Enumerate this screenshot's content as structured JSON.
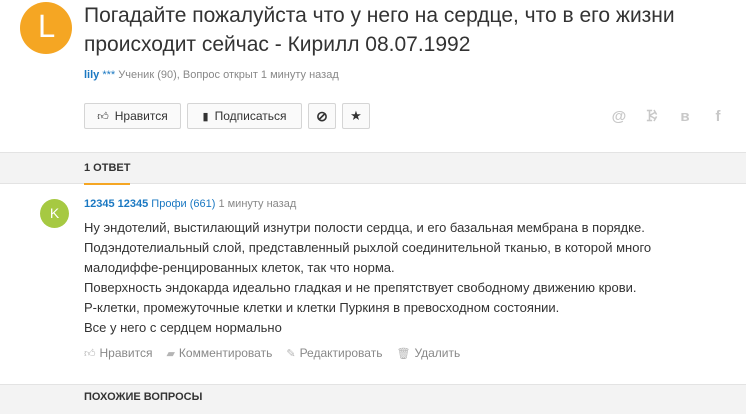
{
  "question": {
    "avatar_letter": "L",
    "title": "Погадайте пожалуйста что у него на сердце, что в его жизни происходит сейчас - Кирилл 08.07.1992",
    "author": "lily",
    "author_stars": "***",
    "meta_text": "Ученик (90), Вопрос открыт 1 минуту назад"
  },
  "actions": {
    "like_label": "Нравится",
    "subscribe_label": "Подписаться"
  },
  "share_icons": [
    "mail-ru-icon",
    "odnoklassniki-icon",
    "vkontakte-icon",
    "facebook-icon"
  ],
  "answers_tab": {
    "label": "1 ОТВЕТ"
  },
  "answer": {
    "avatar_letter": "K",
    "author": "12345 12345",
    "rank": "Профи (661)",
    "time": "1 минуту назад",
    "lines": [
      "Ну эндотелий, выстилающий изнутри полости сердца, и его базальная мембрана в порядке.",
      "Подэндотелиальный слой, представленный рыхлой соединительной тканью, в которой много",
      "малодиффе-ренцированных клеток, так что норма.",
      "Поверхность эндокарда идеально гладкая и не препятствует свободному движению крови.",
      "Р-клетки, промежуточные клетки и клетки Пуркиня в превосходном состоянии.",
      "Все у него с сердцем нормально"
    ],
    "actions": {
      "like": "Нравится",
      "comment": "Комментировать",
      "edit": "Редактировать",
      "delete": "Удалить"
    }
  },
  "similar": {
    "label": "ПОХОЖИЕ ВОПРОСЫ"
  },
  "colors": {
    "avatar_question": "#f5a623",
    "avatar_answer": "#a6c942",
    "link": "#1a78c2",
    "tab_underline": "#f5a623"
  }
}
